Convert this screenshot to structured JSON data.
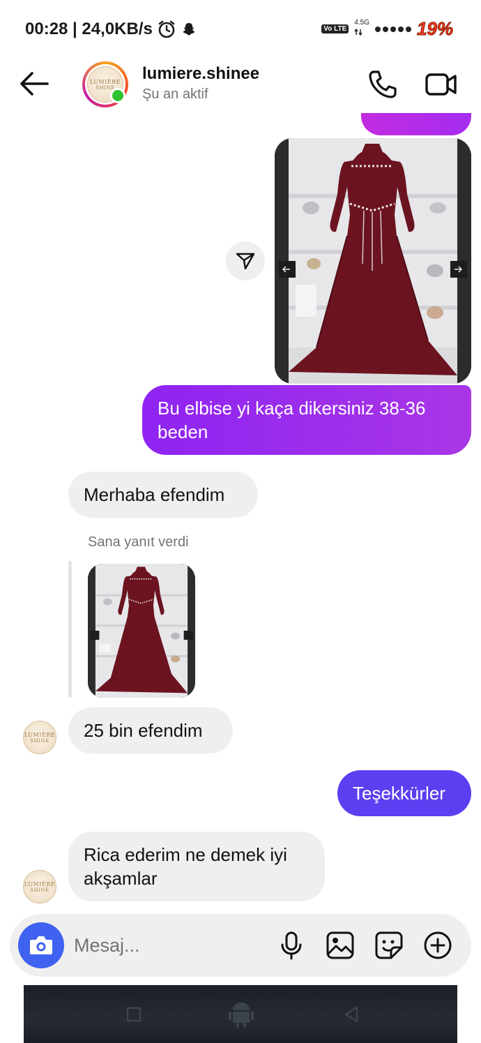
{
  "status_bar": {
    "time_and_speed": "00:28 | 24,0KB/s",
    "volte": "Vo LTE",
    "network": "4.5G",
    "battery": "19%"
  },
  "header": {
    "username": "lumiere.shinee",
    "status": "Şu an aktif",
    "logo_line1": "LUMIÈRE",
    "logo_line2": "SHINE"
  },
  "messages": [
    {
      "id": "out-1",
      "side": "sent",
      "text": "Bu elbise yi kaça dikersiniz 38-36 beden"
    },
    {
      "id": "in-1",
      "side": "received",
      "text": "Merhaba efendim"
    },
    {
      "id": "reply-label",
      "text": "Sana yanıt verdi"
    },
    {
      "id": "in-2",
      "side": "received",
      "text": "25 bin efendim"
    },
    {
      "id": "out-2",
      "side": "sent",
      "text": "Teşekkürler"
    },
    {
      "id": "in-3",
      "side": "received",
      "text": "Rica ederim ne demek iyi akşamlar"
    }
  ],
  "composer": {
    "placeholder": "Mesaj...",
    "icons": [
      "camera-icon",
      "microphone-icon",
      "gallery-icon",
      "sticker-icon",
      "plus-icon"
    ]
  },
  "colors": {
    "sent_gradient_start": "#8f24f2",
    "sent_gradient_end": "#a936e6",
    "sent_blue": "#5b3ff0",
    "received_bg": "#efefef",
    "online_dot": "#2fc12f",
    "camera_button": "#3f62f0",
    "battery_text": "#ff3b1f",
    "dress": "#6b1420"
  }
}
